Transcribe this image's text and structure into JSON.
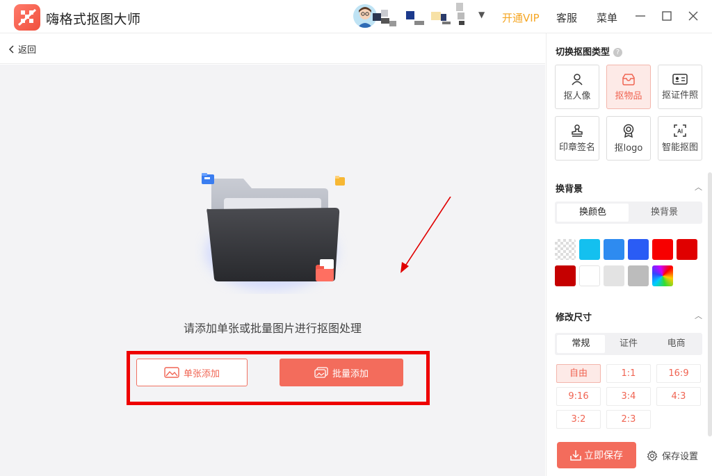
{
  "titlebar": {
    "app_title": "嗨格式抠图大师",
    "vip_label": "开通VIP",
    "service_label": "客服",
    "menu_label": "菜单",
    "caret": "▼"
  },
  "subbar": {
    "back_label": "返回"
  },
  "main": {
    "prompt": "请添加单张或批量图片进行抠图处理",
    "single_add_label": "单张添加",
    "batch_add_label": "批量添加"
  },
  "panel": {
    "cutout_type_title": "切换抠图类型",
    "help": "?",
    "types": [
      {
        "label": "抠人像",
        "icon": "person-icon",
        "active": false
      },
      {
        "label": "抠物品",
        "icon": "box-icon",
        "active": true
      },
      {
        "label": "抠证件照",
        "icon": "id-card-icon",
        "active": false
      },
      {
        "label": "印章签名",
        "icon": "stamp-icon",
        "active": false
      },
      {
        "label": "抠logo",
        "icon": "badge-icon",
        "active": false
      },
      {
        "label": "智能抠图",
        "icon": "ai-icon",
        "active": false
      }
    ],
    "background_title": "换背景",
    "background_tabs": [
      "换颜色",
      "换背景"
    ],
    "swatch_colors": [
      "transparent",
      "#14c0ef",
      "#2e8bf0",
      "#2a5cf5",
      "#f70000",
      "#e00000",
      "#c50000",
      "#ffffff",
      "#e3e3e3",
      "#bcbcbc",
      "gradient"
    ],
    "size_title": "修改尺寸",
    "size_tabs": [
      "常规",
      "证件",
      "电商"
    ],
    "ratios": [
      "自由",
      "1:1",
      "16:9",
      "9:16",
      "3:4",
      "4:3",
      "3:2",
      "2:3"
    ],
    "save_label": "立即保存",
    "save_settings_label": "保存设置"
  },
  "colors": {
    "accent": "#f36c5c",
    "vip": "#f5a623",
    "highlight": "#ee0000"
  }
}
